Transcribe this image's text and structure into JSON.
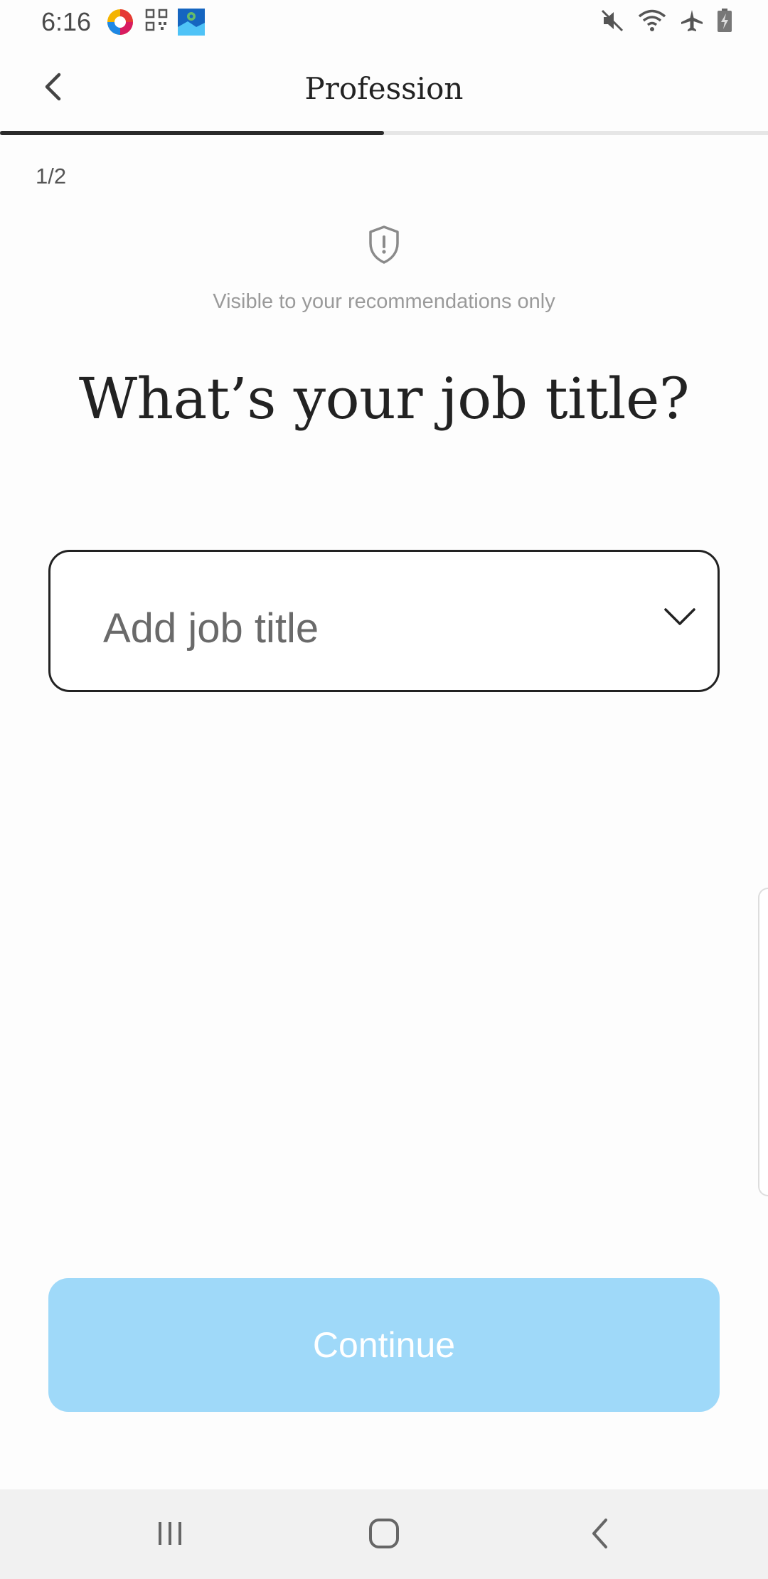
{
  "status_bar": {
    "time": "6:16",
    "left_icons": [
      "browser-app-icon",
      "qr-scanner-app-icon",
      "maps-app-icon"
    ],
    "right_icons": [
      "mute-icon",
      "wifi-icon",
      "airplane-mode-icon",
      "battery-charging-icon"
    ]
  },
  "header": {
    "title": "Profession",
    "back_icon": "chevron-left-icon"
  },
  "progress": {
    "fraction": 0.5,
    "step_text": "1/2"
  },
  "visibility": {
    "icon": "shield-icon",
    "note": "Visible to your recommendations only"
  },
  "question": {
    "heading": "What’s your job title?"
  },
  "job_title_field": {
    "placeholder": "Add job title",
    "icon": "chevron-down-icon"
  },
  "actions": {
    "continue_label": "Continue",
    "continue_color": "#9fd9f9"
  },
  "nav_bar": {
    "items": [
      "recent-apps-icon",
      "home-icon",
      "back-icon"
    ]
  },
  "colors": {
    "background": "#fdfdfd",
    "text_primary": "#222222",
    "text_muted": "#9a9a9a",
    "progress_fill": "#2b2b2b",
    "progress_track": "#e6e6e6"
  }
}
